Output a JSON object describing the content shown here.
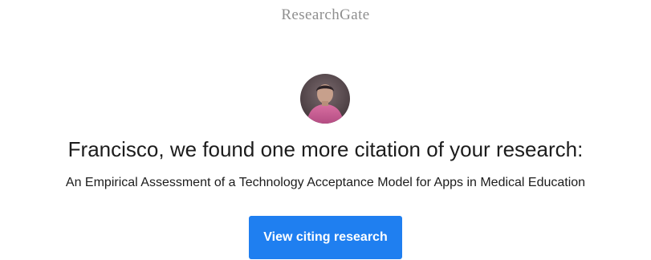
{
  "header": {
    "brand": "ResearchGate"
  },
  "recipient": {
    "avatar_icon": "user-avatar-photo"
  },
  "message": {
    "headline": "Francisco, we found one more citation of your research:",
    "paper_title": "An Empirical Assessment of a Technology Acceptance Model for Apps in Medical Education"
  },
  "actions": {
    "view_citing_label": "View citing research",
    "button_color": "#1f7ff0"
  }
}
